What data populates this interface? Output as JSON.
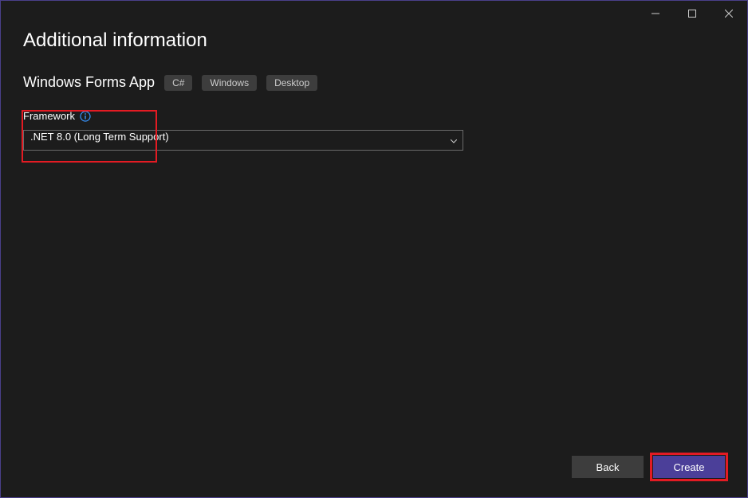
{
  "titlebar": {
    "minimize": "minimize",
    "maximize": "maximize",
    "close": "close"
  },
  "page": {
    "title": "Additional information",
    "template_name": "Windows Forms App",
    "tags": [
      "C#",
      "Windows",
      "Desktop"
    ]
  },
  "framework": {
    "label": "Framework",
    "selected": ".NET 8.0 (Long Term Support)"
  },
  "footer": {
    "back": "Back",
    "create": "Create"
  }
}
